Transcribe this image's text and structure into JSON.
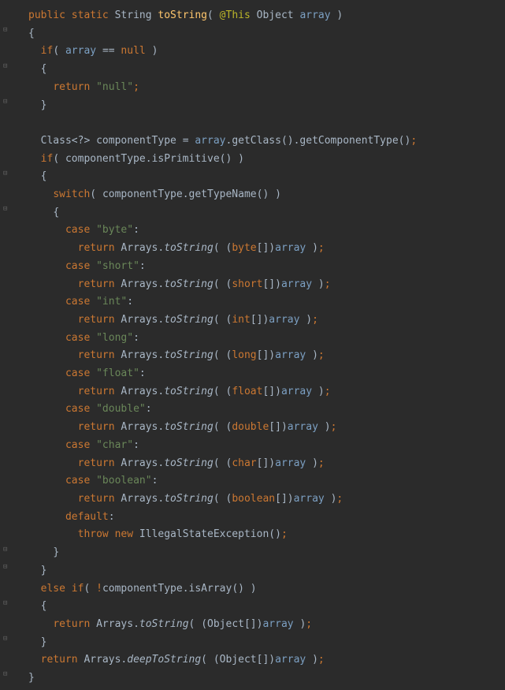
{
  "keywords": {
    "public": "public",
    "static": "static",
    "if": "if",
    "else": "else",
    "return": "return",
    "switch": "switch",
    "case": "case",
    "default": "default",
    "throw": "throw",
    "new": "new",
    "null": "null"
  },
  "types": {
    "String": "String",
    "Object": "Object",
    "Class": "Class",
    "Arrays": "Arrays",
    "IllegalStateException": "IllegalStateException"
  },
  "prim": {
    "byte": "byte",
    "short": "short",
    "int": "int",
    "long": "long",
    "float": "float",
    "double": "double",
    "char": "char",
    "boolean": "boolean"
  },
  "annotation": "@This",
  "methodName": "toString",
  "param": "array",
  "local": "componentType",
  "calls": {
    "getClass": "getClass",
    "getComponentType": "getComponentType",
    "isPrimitive": "isPrimitive",
    "getTypeName": "getTypeName",
    "isArray": "isArray",
    "toString": "toString",
    "deepToString": "deepToString"
  },
  "strings": {
    "null": "\"null\"",
    "byte": "\"byte\"",
    "short": "\"short\"",
    "int": "\"int\"",
    "long": "\"long\"",
    "float": "\"float\"",
    "double": "\"double\"",
    "char": "\"char\"",
    "boolean": "\"boolean\""
  },
  "generics": "<?>",
  "brackets": "[]",
  "eqeq": "==",
  "assign": "=",
  "semi": ";",
  "colon": ":",
  "dot": ".",
  "comma": ",",
  "excl": "!",
  "lparen": "(",
  "rparen": ")",
  "lbrace": "{",
  "rbrace": "}",
  "foldGlyph": "⊟"
}
